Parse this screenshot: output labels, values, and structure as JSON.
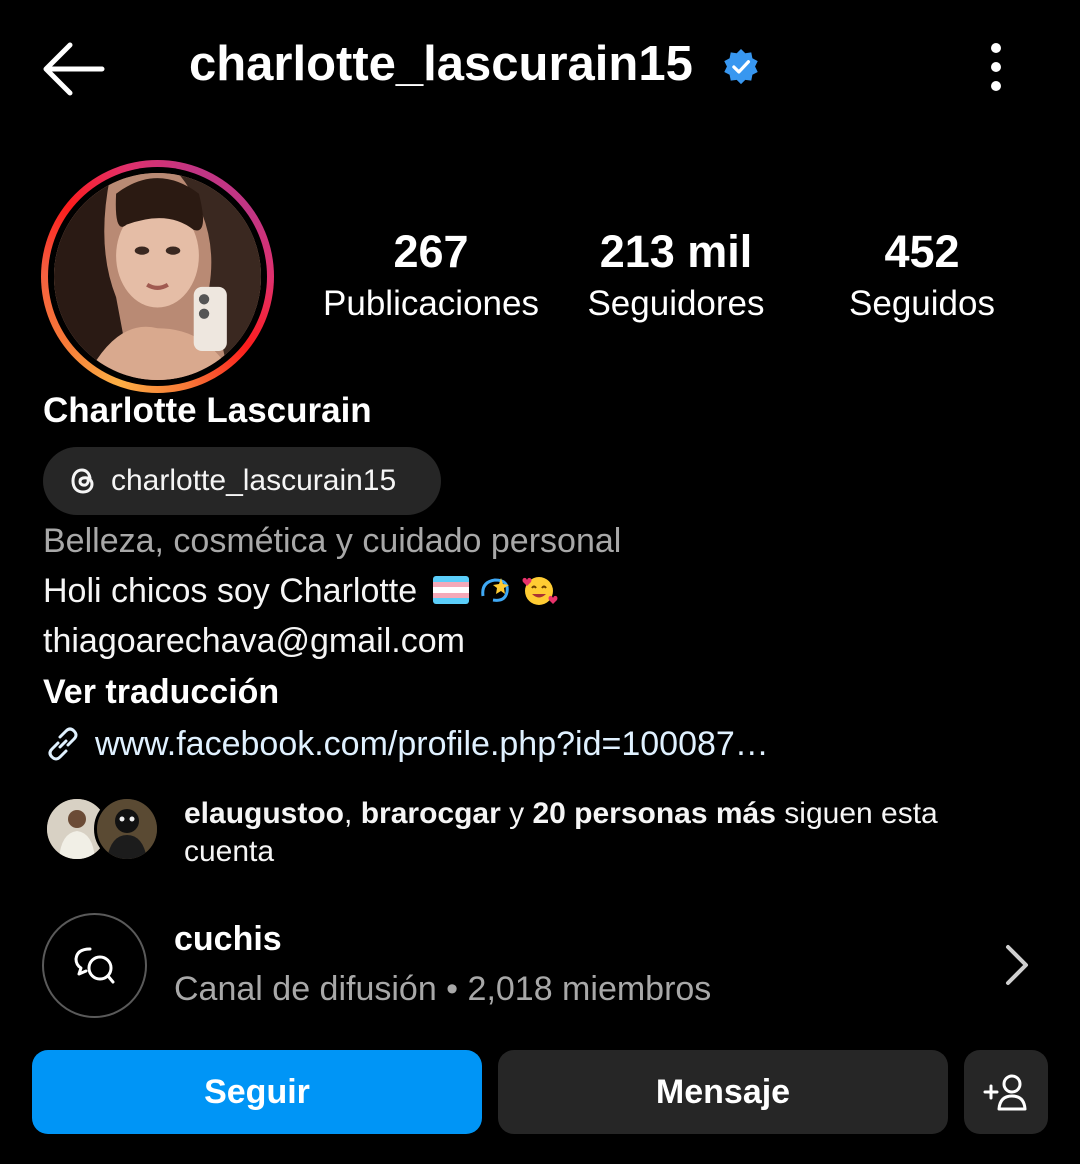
{
  "header": {
    "username": "charlotte_lascurain15",
    "verified": true,
    "back_icon": "arrow-left-icon",
    "more_icon": "more-vertical-icon"
  },
  "colors": {
    "background": "#000000",
    "accent_blue": "#0095f6",
    "verified_blue": "#3897f0",
    "secondary_text": "#a8a8a8",
    "button_dark": "#262626",
    "link_text": "#e0f1ff"
  },
  "profile": {
    "stats": [
      {
        "value": "267",
        "label": "Publicaciones"
      },
      {
        "value": "213 mil",
        "label": "Seguidores"
      },
      {
        "value": "452",
        "label": "Seguidos"
      }
    ],
    "display_name": "Charlotte Lascurain",
    "threads_handle": "charlotte_lascurain15",
    "category": "Belleza, cosmética y cuidado personal",
    "bio_text": "Holi chicos soy Charlotte",
    "email": "thiagoarechava@gmail.com",
    "translate": "Ver traducción",
    "link": "www.facebook.com/profile.php?id=100087…"
  },
  "followed_by": {
    "user1": "elaugustoo",
    "separator": ",",
    "user2": "brarocgar",
    "mid": "y",
    "others": "20 personas más",
    "end": "siguen esta cuenta"
  },
  "channel": {
    "name": "cuchis",
    "meta": "Canal de difusión • 2,018 miembros"
  },
  "actions": {
    "follow": "Seguir",
    "message": "Mensaje",
    "suggest_icon": "add-person-icon"
  }
}
